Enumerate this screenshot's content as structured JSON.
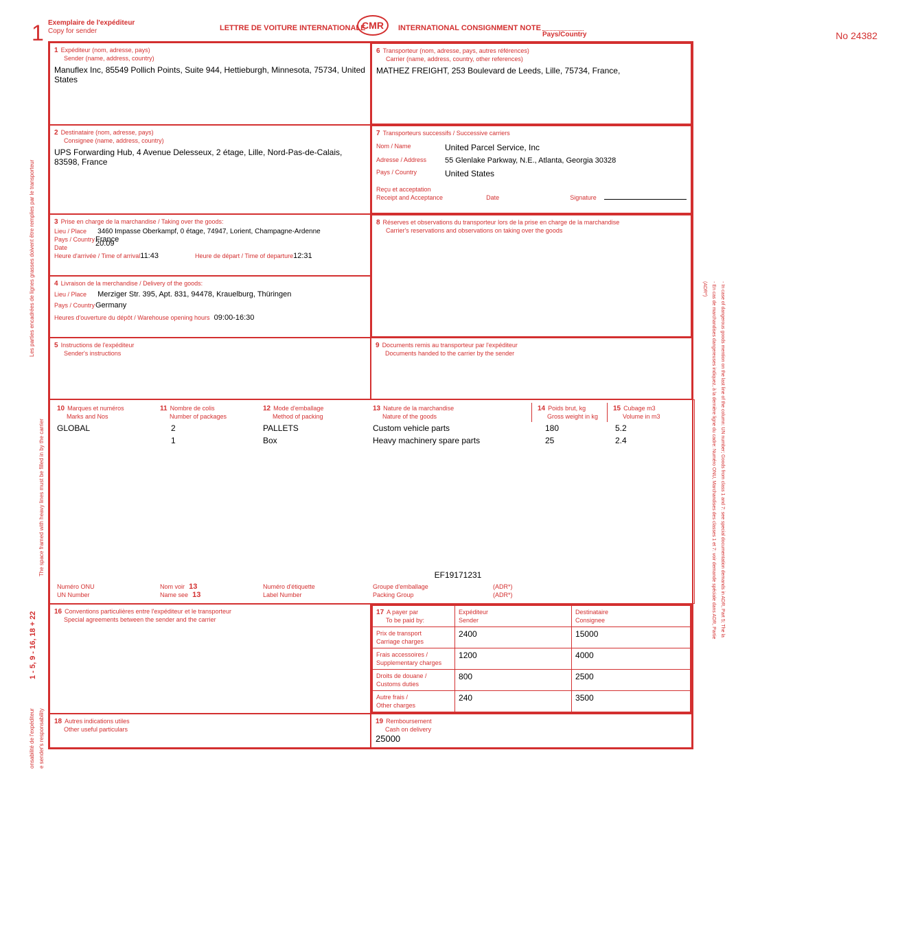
{
  "header": {
    "copy_num": "1",
    "copy_fr": "Exemplaire de l'expéditeur",
    "copy_en": "Copy for sender",
    "title_fr": "LETTRE DE VOITURE INTERNATIONALE",
    "badge": "CMR",
    "title_en": "INTERNATIONAL CONSIGNMENT NOTE",
    "pays": "Pays/Country",
    "no": "No 24382"
  },
  "box1": {
    "num": "1",
    "fr": "Expéditeur (nom, adresse, pays)",
    "en": "Sender (name, address, country)",
    "value": "Manuflex Inc, 85549 Pollich Points, Suite 944, Hettieburgh, Minnesota, 75734, United States"
  },
  "box2": {
    "num": "2",
    "fr": "Destinataire (nom, adresse, pays)",
    "en": "Consignee (name, address, country)",
    "value": "UPS Forwarding Hub, 4 Avenue Delesseux, 2 étage, Lille, Nord-Pas-de-Calais, 83598, France"
  },
  "box3": {
    "num": "3",
    "title": "Prise en charge de la marchandise / Taking over the goods:",
    "lieu_lbl": "Lieu / Place",
    "lieu": "3460 Impasse Oberkampf, 0 étage, 74947, Lorient, Champagne-Ardenne",
    "pays_lbl": "Pays / Country",
    "pays": "France",
    "date_lbl": "Date",
    "date": "20.09",
    "arr_lbl": "Heure d'arrivée / Time of arrival",
    "arr": "11:43",
    "dep_lbl": "Heure de départ / Time of departure",
    "dep": "12:31"
  },
  "box4": {
    "num": "4",
    "title": "Livraison de la merchandise / Delivery of the goods:",
    "lieu_lbl": "Lieu / Place",
    "lieu": "Merziger Str. 395, Apt. 831, 94478, Krauelburg, Thüringen",
    "pays_lbl": "Pays / Country",
    "pays": "Germany",
    "hours_lbl": "Heures d'ouverture du dépôt / Warehouse opening hours",
    "hours": "09:00-16:30"
  },
  "box5": {
    "num": "5",
    "fr": "Instructions de l'expéditeur",
    "en": "Sender's instructions"
  },
  "box6": {
    "num": "6",
    "fr": "Transporteur (nom, adresse, pays, autres références)",
    "en": "Carrier (name, address, country, other references)",
    "value": "MATHEZ FREIGHT, 253 Boulevard de Leeds, Lille, 75734, France,"
  },
  "box7": {
    "num": "7",
    "title": "Transporteurs successifs / Successive carriers",
    "name_lbl": "Nom / Name",
    "name": "United Parcel Service, Inc",
    "addr_lbl": "Adresse / Address",
    "addr": "55 Glenlake Parkway, N.E., Atlanta, Georgia 30328",
    "pays_lbl": "Pays / Country",
    "pays": "United States",
    "recu_fr": "Reçu et acceptation",
    "recu_en": "Receipt and Acceptance",
    "date_lbl": "Date",
    "sig_lbl": "Signature"
  },
  "box8": {
    "num": "8",
    "fr": "Réserves et observations du transporteur lors de la prise en charge de la marchandise",
    "en": "Carrier's reservations and observations on taking over the goods"
  },
  "box9": {
    "num": "9",
    "fr": "Documents remis au transporteur par l'expéditeur",
    "en": "Documents handed to the carrier by the sender"
  },
  "goods": {
    "h10_num": "10",
    "h10_fr": "Marques et numéros",
    "h10_en": "Marks and Nos",
    "h11_num": "11",
    "h11_fr": "Nombre de colis",
    "h11_en": "Number of packages",
    "h12_num": "12",
    "h12_fr": "Mode d'emballage",
    "h12_en": "Method of packing",
    "h13_num": "13",
    "h13_fr": "Nature de la marchandise",
    "h13_en": "Nature of the goods",
    "h14_num": "14",
    "h14_fr": "Poids brut, kg",
    "h14_en": "Gross weight in kg",
    "h15_num": "15",
    "h15_fr": "Cubage m3",
    "h15_en": "Volume in m3",
    "rows": [
      {
        "marks": "GLOBAL",
        "num": "2",
        "pack": "PALLETS",
        "nature": "Custom vehicle parts",
        "weight": "180",
        "vol": "5.2"
      },
      {
        "marks": "",
        "num": "1",
        "pack": "Box",
        "nature": "Heavy machinery spare parts",
        "weight": "25",
        "vol": "2.4"
      }
    ],
    "ef": "EF19171231",
    "onu_fr": "Numéro ONU",
    "onu_en": "UN Number",
    "nom_fr": "Nom voir",
    "nom_en": "Name see",
    "nom_ref": "13",
    "etiq_fr": "Numéro d'étiquette",
    "etiq_en": "Label Number",
    "grp_fr": "Groupe d'emballage",
    "grp_en": "Packing Group",
    "adr": "(ADR*)"
  },
  "box16": {
    "num": "16",
    "fr": "Conventions particulières entre l'expéditeur et le transporteur",
    "en": "Special agreements between the sender and the carrier"
  },
  "box17": {
    "num": "17",
    "paid_fr": "A payer par",
    "paid_en": "To be paid by:",
    "sender_fr": "Expéditeur",
    "sender_en": "Sender",
    "cons_fr": "Destinataire",
    "cons_en": "Consignee",
    "r1_fr": "Prix de transport",
    "r1_en": "Carriage charges",
    "r1s": "2400",
    "r1c": "15000",
    "r2_fr": "Frais accessoires /",
    "r2_en": "Supplementary charges",
    "r2s": "1200",
    "r2c": "4000",
    "r3_fr": "Droits de douane /",
    "r3_en": "Customs duties",
    "r3s": "800",
    "r3c": "2500",
    "r4_fr": "Autre frais /",
    "r4_en": "Other charges",
    "r4s": "240",
    "r4c": "3500"
  },
  "box18": {
    "num": "18",
    "fr": "Autres indications utiles",
    "en": "Other useful particulars"
  },
  "box19": {
    "num": "19",
    "fr": "Remboursement",
    "en": "Cash on delivery",
    "value": "25000"
  },
  "side": {
    "left1a": "Les parties encadrées de lignes grasses doivent être remplies par le transporteur",
    "left1b": "The space framed with heavy lines must be filled in by the carrier",
    "left2": "1 - 5, 9 - 16, 18 + 22",
    "left3a": "onsabilité de l'expéditeur",
    "left3b": "e sender's responsability",
    "right0": "(ADR*)",
    "right1": "- En cas de marchandises dangereuses indiquez, à la dernière ligne du cadre: Numéro ONU, Marchandises des classes 1 et 7: voir demande spéciale dans ADR, Partie",
    "right2": "- In case of dangerous goods mention on the last line of the column: UN number; Goods from class 1 and 7: see special documentation demands in ADR, Part 5; The la"
  }
}
